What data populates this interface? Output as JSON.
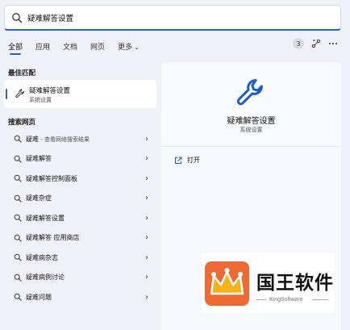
{
  "search": {
    "value": "疑难解答设置"
  },
  "tabs": [
    {
      "label": "全部",
      "active": true
    },
    {
      "label": "应用"
    },
    {
      "label": "文档"
    },
    {
      "label": "网页"
    },
    {
      "label": "更多"
    }
  ],
  "header": {
    "badge_count": "3"
  },
  "sections": {
    "best_match": "最佳匹配",
    "web_search": "搜索网页"
  },
  "best_match": {
    "title": "疑难解答设置",
    "subtitle": "系统设置"
  },
  "web_results": [
    {
      "label": "疑难",
      "suffix": " - 查看网络搜索结果"
    },
    {
      "label": "疑难解答",
      "suffix": ""
    },
    {
      "label": "疑难解答控制面板",
      "suffix": ""
    },
    {
      "label": "疑难杂症",
      "suffix": ""
    },
    {
      "label": "疑难解答设置",
      "suffix": ""
    },
    {
      "label": "疑难解答 应用商店",
      "suffix": ""
    },
    {
      "label": "疑难病杂志",
      "suffix": ""
    },
    {
      "label": "疑难病例讨论",
      "suffix": ""
    },
    {
      "label": "疑难问题",
      "suffix": ""
    }
  ],
  "detail": {
    "title": "疑难解答设置",
    "subtitle": "系统设置",
    "open_label": "打开"
  },
  "watermark": {
    "name": "国王软件",
    "en": "KingSoftware"
  },
  "colors": {
    "accent": "#2a63c9",
    "background": "#eef1f7",
    "logo_orange": "#ef6a33",
    "crown_yellow": "#f7b21b"
  }
}
